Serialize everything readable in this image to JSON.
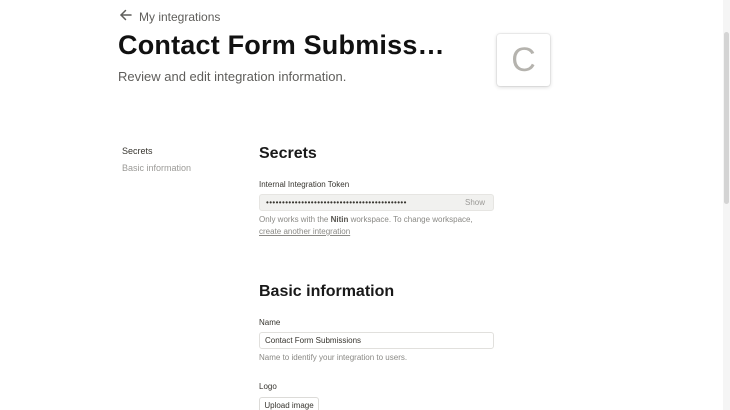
{
  "header": {
    "back_label": "My integrations",
    "title": "Contact Form Submiss…",
    "subtitle": "Review and edit integration information.",
    "logo_letter": "C"
  },
  "sidenav": {
    "items": [
      {
        "label": "Secrets",
        "active": true
      },
      {
        "label": "Basic information",
        "active": false
      }
    ]
  },
  "secrets": {
    "title": "Secrets",
    "token_label": "Internal Integration Token",
    "token_masked": "••••••••••••••••••••••••••••••••••••••••••••",
    "show_label": "Show",
    "help_prefix": "Only works with the ",
    "workspace_name": "Nitin",
    "help_suffix": " workspace. To change workspace,",
    "help_link": "create another integration"
  },
  "basic_info": {
    "title": "Basic information",
    "name_label": "Name",
    "name_value": "Contact Form Submissions",
    "name_help": "Name to identify your integration to users.",
    "logo_label": "Logo",
    "upload_label": "Upload image"
  }
}
